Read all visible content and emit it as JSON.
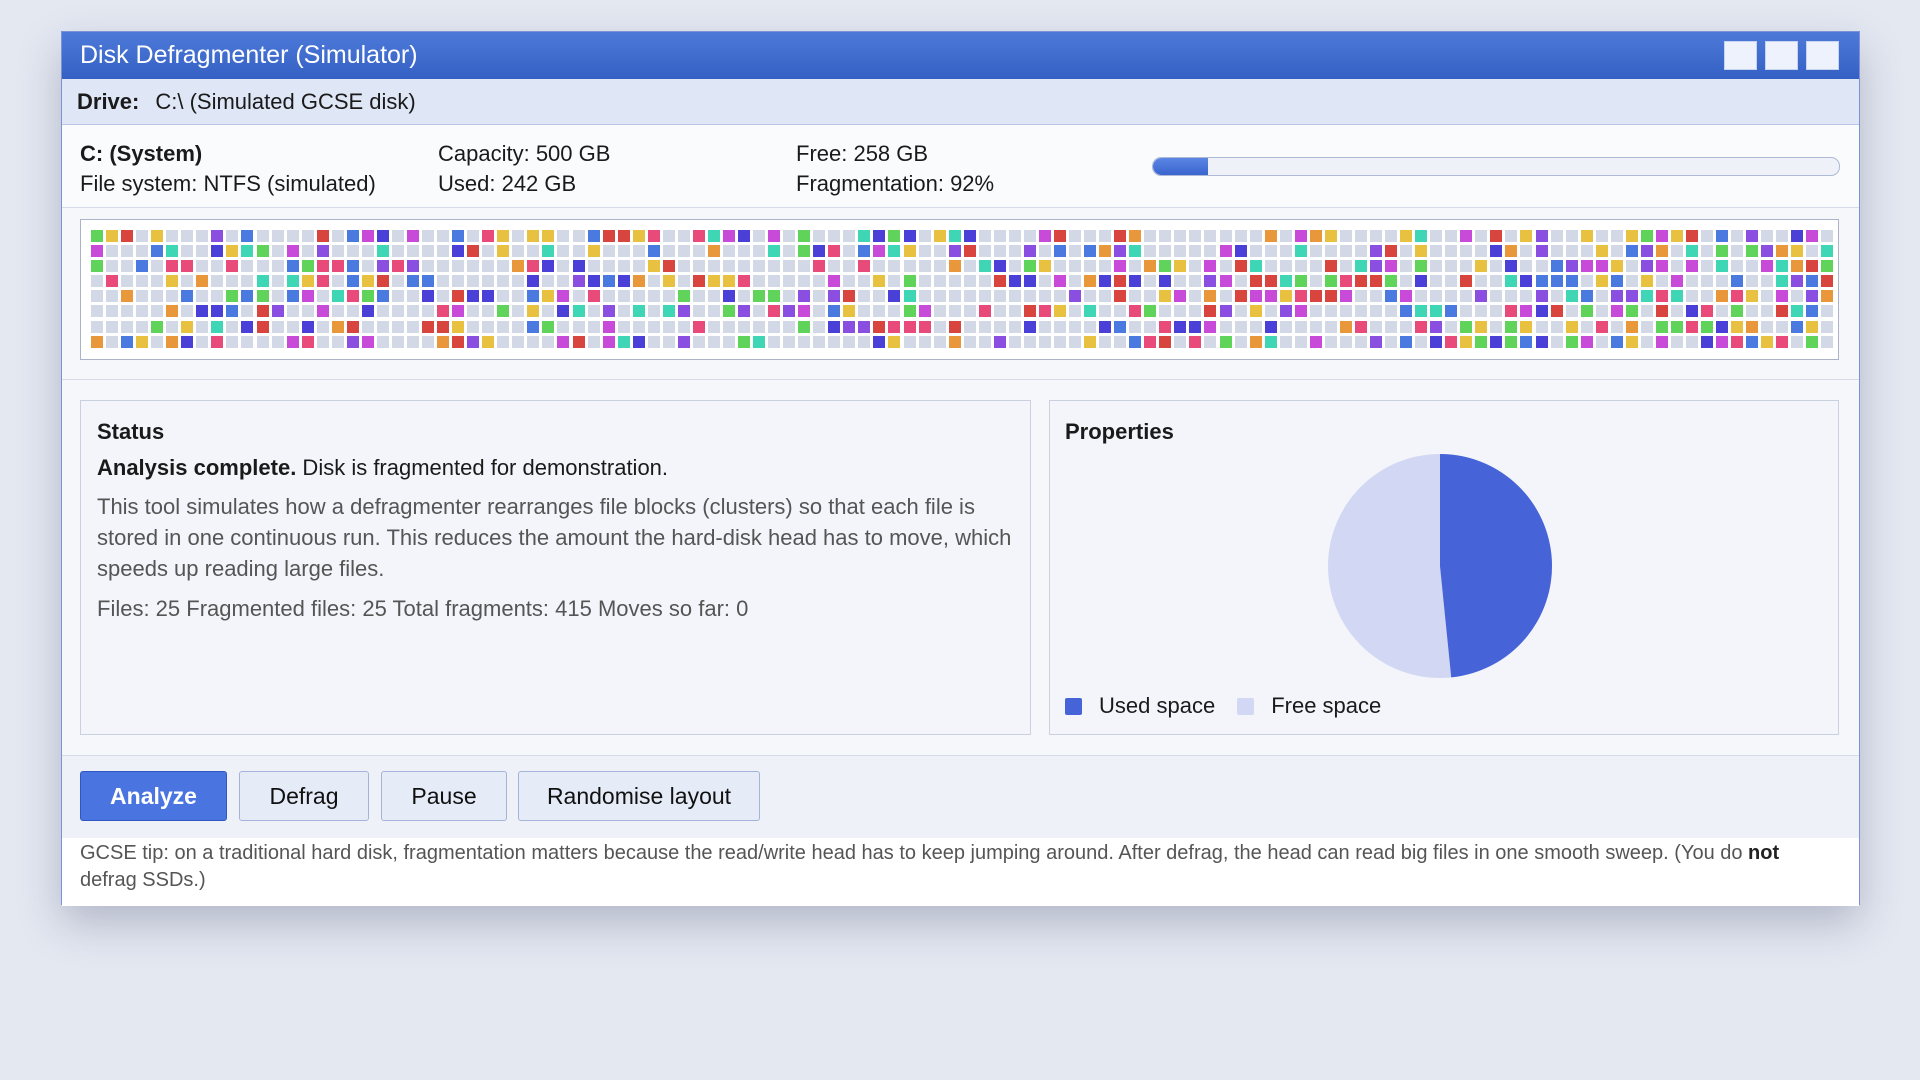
{
  "window": {
    "title": "Disk Defragmenter (Simulator)"
  },
  "drive": {
    "label": "Drive:",
    "value": "C:\\ (Simulated GCSE disk)"
  },
  "info": {
    "name": "C: (System)",
    "filesystem": "File system: NTFS (simulated)",
    "capacity": "Capacity: 500 GB",
    "used": "Used: 242 GB",
    "free": "Free: 258 GB",
    "fragmentation": "Fragmentation: 92%",
    "progress_fraction": 0.08
  },
  "cluster_map": {
    "columns": 116,
    "rows": 8,
    "palette": [
      "#e84a7a",
      "#8a4fe0",
      "#3ed6b5",
      "#e8c140",
      "#4a7ae0",
      "#5fd35a",
      "#d8453e",
      "#e8983a",
      "#c84ad8",
      "#4a3fd6"
    ],
    "empty_color": "#d3d8e6"
  },
  "status": {
    "heading": "Status",
    "headline_bold": "Analysis complete.",
    "headline_rest": " Disk is fragmented for demonstration.",
    "description": "This tool simulates how a defragmenter rearranges file blocks (clusters) so that each file is stored in one continuous run. This reduces the amount the hard-disk head has to move, which speeds up reading large files.",
    "stats": "Files: 25 Fragmented files: 25 Total fragments: 415 Moves so far: 0"
  },
  "properties": {
    "heading": "Properties",
    "used_gb": 242,
    "free_gb": 258,
    "used_color": "#4763d8",
    "free_color": "#d2d8f3",
    "legend_used": "Used space",
    "legend_free": "Free space"
  },
  "buttons": {
    "analyze": "Analyze",
    "defrag": "Defrag",
    "pause": "Pause",
    "randomise": "Randomise layout"
  },
  "tip": {
    "before": "GCSE tip: on a traditional hard disk, fragmentation matters because the read/write head has to keep jumping around. After defrag, the head can read big files in one smooth sweep. (You do ",
    "bold": "not",
    "after": " defrag SSDs.)"
  }
}
